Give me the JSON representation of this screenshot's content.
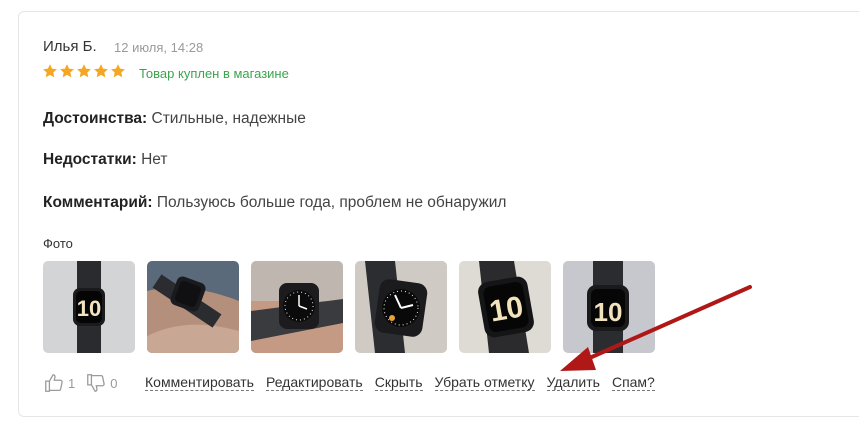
{
  "review": {
    "author": "Илья Б.",
    "date": "12 июля, 14:28",
    "rating": 5,
    "bought_label": "Товар куплен в магазине",
    "pros_label": "Достоинства:",
    "pros_text": " Стильные, надежные",
    "cons_label": "Недостатки:",
    "cons_text": " Нет",
    "comment_label": "Комментарий:",
    "comment_text": " Пользуюсь больше года, проблем не обнаружил",
    "photo_label": "Фото",
    "likes": "1",
    "dislikes": "0"
  },
  "actions": {
    "comment": "Комментировать",
    "edit": "Редактировать",
    "hide": "Скрыть",
    "remove_mark": "Убрать отметку",
    "delete": "Удалить",
    "spam": "Спам?"
  },
  "colors": {
    "star": "#f5a623",
    "bought": "#3aa54b",
    "arrow": "#b01818"
  }
}
